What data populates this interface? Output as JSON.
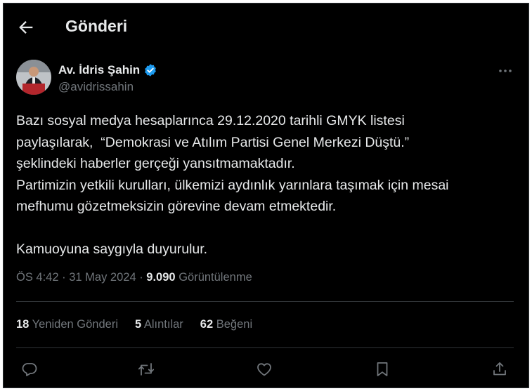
{
  "header": {
    "title": "Gönderi"
  },
  "author": {
    "display_name": "Av. İdris Şahin",
    "handle": "@avidrissahin"
  },
  "tweet": {
    "text": "Bazı sosyal medya hesaplarınca 29.12.2020 tarihli GMYK listesi\npaylaşılarak,  “Demokrasi ve Atılım Partisi Genel Merkezi Düştü.”\nşeklindeki haberler gerçeği yansıtmamaktadır.\nPartimizin yetkili kurulları, ülkemizi aydınlık yarınlara taşımak için mesai\nmefhumu gözetmeksizin görevine devam etmektedir.\n\nKamuoyuna saygıyla duyurulur.",
    "time": "ÖS 4:42",
    "separator": " · ",
    "date": "31 May 2024",
    "views_count": "9.090",
    "views_label": "Görüntülenme"
  },
  "stats": {
    "reposts_count": "18",
    "reposts_label": "Yeniden Gönderi",
    "quotes_count": "5",
    "quotes_label": "Alıntılar",
    "likes_count": "62",
    "likes_label": "Beğeni"
  },
  "icons": {
    "back": "arrow-left-icon",
    "verified": "verified-badge-icon",
    "more": "more-horizontal-icon",
    "reply": "reply-icon",
    "repost": "repost-icon",
    "like": "heart-icon",
    "bookmark": "bookmark-icon",
    "share": "share-icon"
  },
  "colors": {
    "background": "#000000",
    "text": "#e7e9ea",
    "secondary": "#71767b",
    "verified": "#1d9bf0",
    "divider": "#2f3336"
  }
}
